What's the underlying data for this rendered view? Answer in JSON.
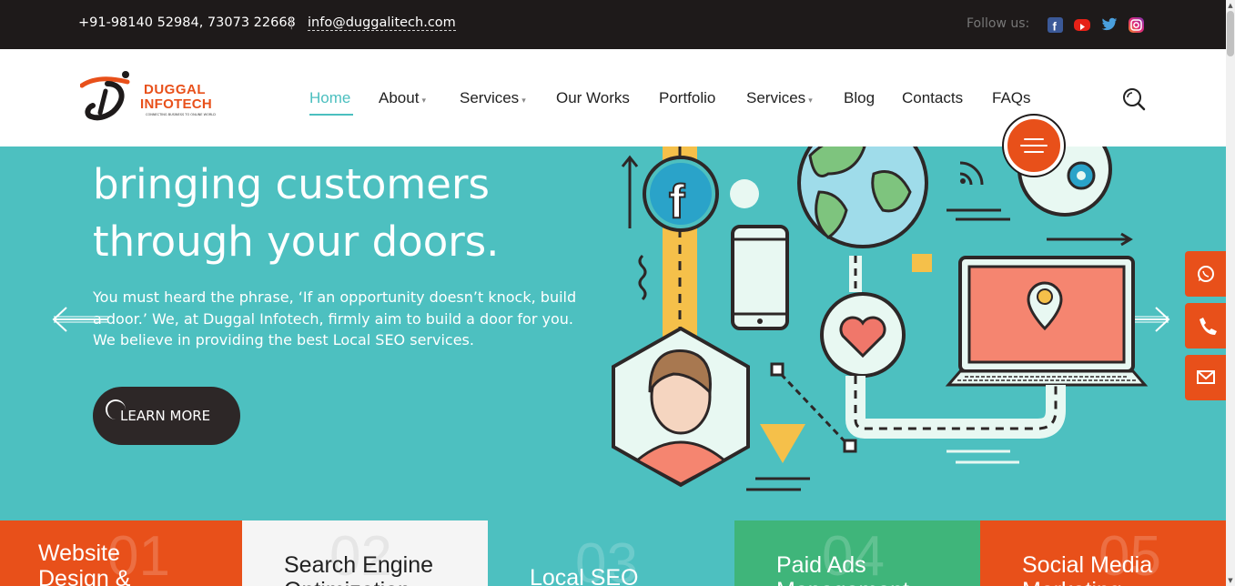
{
  "topbar": {
    "phone": "+91-98140 52984, 73073 22668",
    "separator": "|",
    "email": "info@duggalitech.com",
    "follow_label": "Follow us:",
    "social": [
      "facebook-icon",
      "youtube-icon",
      "twitter-icon",
      "instagram-icon"
    ]
  },
  "logo": {
    "line1": "DUGGAL",
    "line2": "INFOTECH",
    "tagline": "CONNECTING BUSINESS TO ONLINE WORLD"
  },
  "nav": {
    "items": [
      {
        "label": "Home",
        "active": true,
        "dropdown": false
      },
      {
        "label": "About",
        "dropdown": true
      },
      {
        "label": "Services",
        "dropdown": true
      },
      {
        "label": "Our Works",
        "dropdown": false
      },
      {
        "label": "Portfolio",
        "dropdown": false
      },
      {
        "label": "Services",
        "dropdown": true
      },
      {
        "label": "Blog",
        "dropdown": false
      },
      {
        "label": "Contacts",
        "dropdown": false
      },
      {
        "label": "FAQs",
        "dropdown": false
      }
    ]
  },
  "hero": {
    "headline_line1": "bringing customers",
    "headline_line2": "through your doors.",
    "paragraph": "You must heard the phrase, ‘If an opportunity doesn’t knock, build a door.’ We, at Duggal Infotech, firmly aim to build a door for you. We believe in providing the best Local SEO services.",
    "button": "LEARN MORE"
  },
  "services": [
    {
      "num": "01",
      "title_line1": "Website",
      "title_line2": "Design &"
    },
    {
      "num": "02",
      "title_line1": "Search Engine",
      "title_line2": "Optimization"
    },
    {
      "num": "03",
      "title_line1": "Local SEO",
      "title_line2": ""
    },
    {
      "num": "04",
      "title_line1": "Paid Ads",
      "title_line2": "Management"
    },
    {
      "num": "05",
      "title_line1": "Social Media",
      "title_line2": "Marketing"
    }
  ],
  "colors": {
    "accent": "#e8501a",
    "teal": "#4dc0c0",
    "dark": "#1e1a1a",
    "green": "#3fb57a"
  }
}
